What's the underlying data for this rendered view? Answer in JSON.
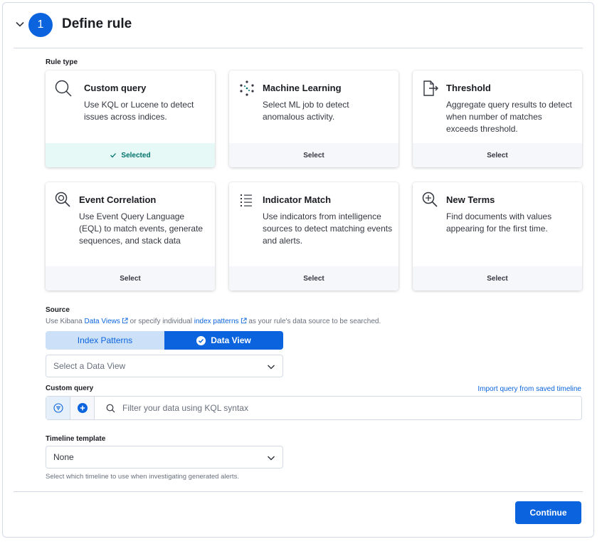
{
  "header": {
    "step_number": "1",
    "title": "Define rule"
  },
  "rule_type": {
    "label": "Rule type",
    "cards": [
      {
        "title": "Custom query",
        "description": "Use KQL or Lucene to detect issues across indices.",
        "footer": "Selected",
        "icon": "search-icon"
      },
      {
        "title": "Machine Learning",
        "description": "Select ML job to detect anomalous activity.",
        "footer": "Select",
        "icon": "ml-icon"
      },
      {
        "title": "Threshold",
        "description": "Aggregate query results to detect when number of matches exceeds threshold.",
        "footer": "Select",
        "icon": "threshold-icon"
      },
      {
        "title": "Event Correlation",
        "description": "Use Event Query Language (EQL) to match events, generate sequences, and stack data",
        "footer": "Select",
        "icon": "eql-icon"
      },
      {
        "title": "Indicator Match",
        "description": "Use indicators from intelligence sources to detect matching events and alerts.",
        "footer": "Select",
        "icon": "list-icon"
      },
      {
        "title": "New Terms",
        "description": "Find documents with values appearing for the first time.",
        "footer": "Select",
        "icon": "zoom-in-icon"
      }
    ]
  },
  "source": {
    "label": "Source",
    "desc_prefix": "Use Kibana ",
    "link_data_views": "Data Views",
    "desc_middle": " or specify individual ",
    "link_index_patterns": "index patterns",
    "desc_suffix": " as your rule's data source to be searched.",
    "toggle_index_patterns": "Index Patterns",
    "toggle_data_view": "Data View",
    "data_view_placeholder": "Select a Data View"
  },
  "custom_query": {
    "label": "Custom query",
    "import_link": "Import query from saved timeline",
    "placeholder": "Filter your data using KQL syntax"
  },
  "timeline": {
    "label": "Timeline template",
    "value": "None",
    "help": "Select which timeline to use when investigating generated alerts."
  },
  "actions": {
    "continue_label": "Continue"
  },
  "colors": {
    "primary": "#0b64dd",
    "success": "#00726b",
    "border": "#d3dae6"
  }
}
